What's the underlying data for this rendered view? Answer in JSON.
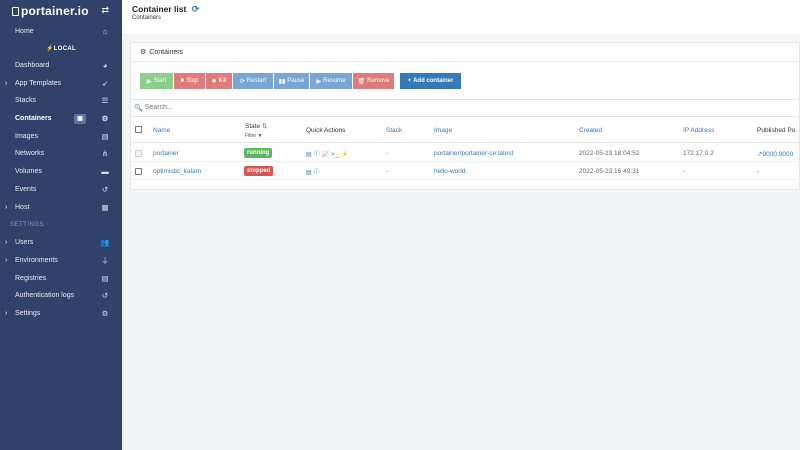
{
  "sidebar": {
    "brand": "portainer.io",
    "env_label": "LOCAL",
    "settings_section": "SETTINGS",
    "items": [
      {
        "label": "Home",
        "icon": "home-icon"
      },
      {
        "label": "Dashboard",
        "icon": "dashboard-icon"
      },
      {
        "label": "App Templates",
        "icon": "rocket-icon"
      },
      {
        "label": "Stacks",
        "icon": "stacks-icon"
      },
      {
        "label": "Containers",
        "icon": "containers-icon"
      },
      {
        "label": "Images",
        "icon": "images-icon"
      },
      {
        "label": "Networks",
        "icon": "networks-icon"
      },
      {
        "label": "Volumes",
        "icon": "volumes-icon"
      },
      {
        "label": "Events",
        "icon": "history-icon"
      },
      {
        "label": "Host",
        "icon": "grid-icon"
      },
      {
        "label": "Users",
        "icon": "users-icon"
      },
      {
        "label": "Environments",
        "icon": "plug-icon"
      },
      {
        "label": "Registries",
        "icon": "database-icon"
      },
      {
        "label": "Authentication logs",
        "icon": "history-icon"
      },
      {
        "label": "Settings",
        "icon": "cogs-icon"
      }
    ]
  },
  "header": {
    "title": "Container list",
    "breadcrumb": "Containers"
  },
  "widget": {
    "title": "Containers",
    "buttons": {
      "start": "Start",
      "stop": "Stop",
      "kill": "Kill",
      "restart": "Restart",
      "pause": "Pause",
      "resume": "Resume",
      "remove": "Remove",
      "add": "Add container"
    },
    "search_placeholder": "Search...",
    "columns": {
      "name": "Name",
      "state": "State",
      "filter": "Filter",
      "quick_actions": "Quick Actions",
      "stack": "Stack",
      "image": "Image",
      "created": "Created",
      "ip": "IP Address",
      "ports": "Published Po"
    },
    "rows": [
      {
        "name": "portainer",
        "state": "running",
        "stack": "-",
        "image": "portainer/portainer-ce:latest",
        "created": "2022-05-23 18:04:52",
        "ip": "172.17.0.2",
        "ports": "9000:9000"
      },
      {
        "name": "optimistic_kalam",
        "state": "stopped",
        "stack": "-",
        "image": "hello-world",
        "created": "2022-05-23 16:49:31",
        "ip": "-",
        "ports": "-"
      }
    ]
  },
  "colors": {
    "sidebar_bg": "#30426a",
    "accent": "#337ab7",
    "running": "#5cb85c",
    "stopped": "#d9534f"
  }
}
